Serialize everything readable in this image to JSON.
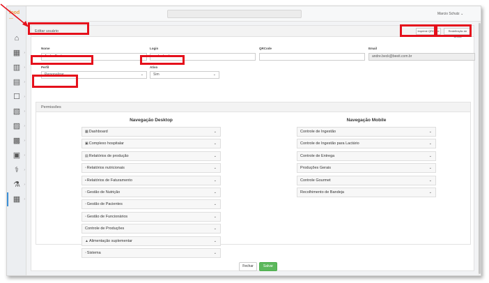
{
  "logo": {
    "line1": "food",
    "line2": "..."
  },
  "sidebar": {
    "items": [
      {
        "icon": "home-icon",
        "glyph": "⌂"
      },
      {
        "icon": "grid-icon",
        "glyph": "▦"
      },
      {
        "icon": "building-icon",
        "glyph": "▥"
      },
      {
        "icon": "clipboard-icon",
        "glyph": "▤"
      },
      {
        "icon": "document-icon",
        "glyph": "☐"
      },
      {
        "icon": "report-icon",
        "glyph": "▧"
      },
      {
        "icon": "tray-icon",
        "glyph": "▨"
      },
      {
        "icon": "chart-icon",
        "glyph": "▩"
      },
      {
        "icon": "hospital-icon",
        "glyph": "▣"
      },
      {
        "icon": "medicine-icon",
        "glyph": "⚕"
      },
      {
        "icon": "flask-icon",
        "glyph": "⚗"
      },
      {
        "icon": "settings-icon",
        "glyph": "▦"
      }
    ]
  },
  "header": {
    "user_menu": "Marcio Schutz ⌄"
  },
  "card": {
    "title": "Editar usuário",
    "btn_print": "Imprimir QRCode",
    "btn_reset": "Redefinição de senha"
  },
  "form": {
    "nome_label": "Nome",
    "nome_value": "Andre Beck",
    "login_label": "Login",
    "login_value": "andre.beck",
    "qrcode_label": "QRCode",
    "qrcode_value": "",
    "email_label": "Email",
    "email_value": "andre.beck@beeit.com.br",
    "perfil_label": "Perfil",
    "perfil_value": "Personalizar",
    "ativo_label": "Ativo",
    "ativo_value": "Sim"
  },
  "permissions": {
    "title": "Permissões",
    "desktop_title": "Navegação Desktop",
    "mobile_title": "Navegação Mobile",
    "desktop": [
      {
        "icon": "dashboard-icon",
        "glyph": "▦",
        "label": "Dashboard"
      },
      {
        "icon": "hospital-icon",
        "glyph": "▣",
        "label": "Complexo hospitalar"
      },
      {
        "icon": "production-icon",
        "glyph": "▤",
        "label": "Relatórios de produção"
      },
      {
        "icon": "nutrition-icon",
        "glyph": "▫",
        "label": "Relatórios nutricionais"
      },
      {
        "icon": "billing-icon",
        "glyph": "▪",
        "label": "Relatórios de Faturamento"
      },
      {
        "icon": "nutrition-management-icon",
        "glyph": "▫",
        "label": "Gestão de Nutrição"
      },
      {
        "icon": "patients-icon",
        "glyph": "▫",
        "label": "Gestão de Pacientes"
      },
      {
        "icon": "employees-icon",
        "glyph": "▫",
        "label": "Gestão de Funcionários"
      },
      {
        "icon": "production-control-icon",
        "glyph": "",
        "label": "Controle de Produções"
      },
      {
        "icon": "flask-icon",
        "glyph": "▲",
        "label": "Alimentação suplementar"
      },
      {
        "icon": "system-icon",
        "glyph": "▫",
        "label": "Sistema"
      }
    ],
    "mobile": [
      {
        "label": "Controle de Ingestão"
      },
      {
        "label": "Controle de Ingestão para Lactário"
      },
      {
        "label": "Controle de Entrega"
      },
      {
        "label": "Produções Gerais"
      },
      {
        "label": "Controle Gourmet"
      },
      {
        "label": "Recolhimento de Bandeja"
      }
    ],
    "chevron": "⌄"
  },
  "footer": {
    "fechar": "Fechar",
    "salvar": "Salvar"
  },
  "colors": {
    "annotation": "#e5101b",
    "save": "#5cb85c",
    "logo": "#f0a048"
  }
}
